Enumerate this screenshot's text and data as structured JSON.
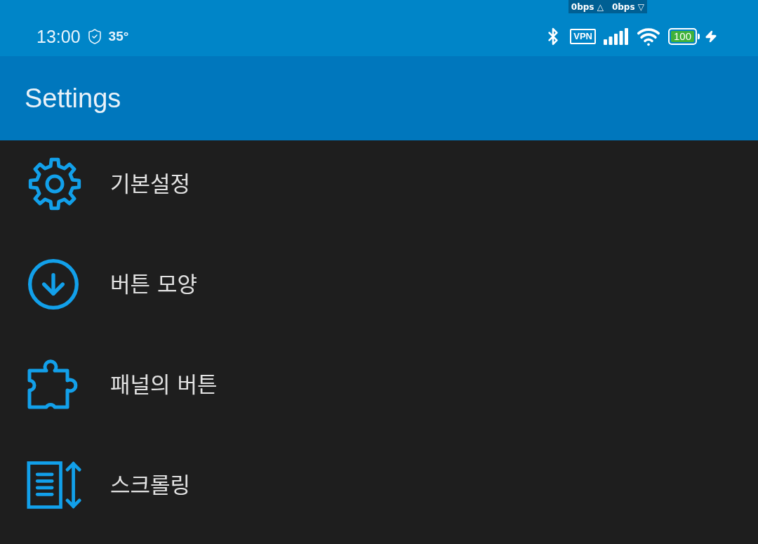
{
  "status_bar": {
    "time": "13:00",
    "temperature": "35°",
    "upload_speed": "0bps △",
    "download_speed": "0bps ▽",
    "vpn_label": "VPN",
    "battery": "100"
  },
  "app_bar": {
    "title": "Settings"
  },
  "menu": {
    "items": [
      {
        "kind": "gear",
        "label": "기본설정"
      },
      {
        "kind": "download",
        "label": "버튼 모양"
      },
      {
        "kind": "puzzle",
        "label": "패널의 버튼"
      },
      {
        "kind": "scroll",
        "label": "스크롤링"
      }
    ]
  }
}
